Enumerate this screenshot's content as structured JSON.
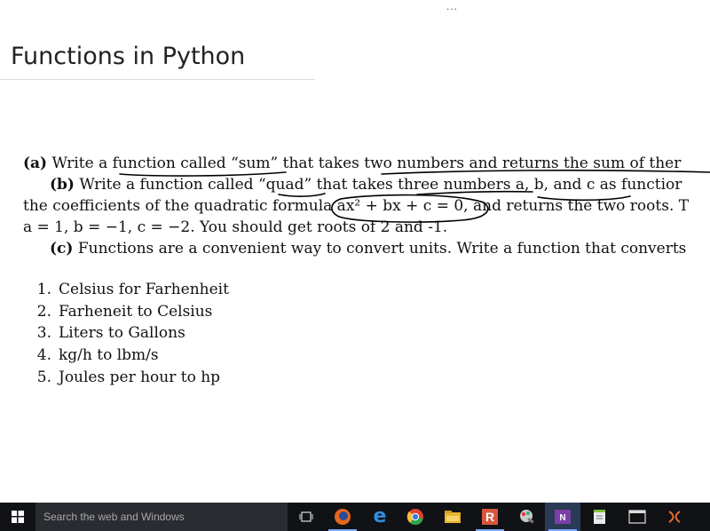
{
  "window": {
    "overflow_dots": "..."
  },
  "slide": {
    "title": "Functions in Python",
    "problem_a": {
      "label": "(a)",
      "text": "Write a function called “sum” that takes two numbers and returns the sum of ther"
    },
    "problem_b": {
      "label": "(b)",
      "line1": "Write a function called “quad” that takes three numbers a, b, and c as functior",
      "line2": "the coefficients of the quadratic formula ax² + bx + c = 0, and returns the two roots.  T",
      "line3": "a = 1, b = −1, c = −2.  You should get roots of 2 and -1."
    },
    "problem_c": {
      "label": "(c)",
      "text": "Functions are a convenient way to convert units.  Write a function that converts"
    },
    "conversions": [
      {
        "num": "1.",
        "text": "Celsius for Farhenheit"
      },
      {
        "num": "2.",
        "text": "Farheneit to Celsius"
      },
      {
        "num": "3.",
        "text": "Liters to Gallons"
      },
      {
        "num": "4.",
        "text": "kg/h to lbm/s"
      },
      {
        "num": "5.",
        "text": "Joules per hour to hp"
      }
    ]
  },
  "taskbar": {
    "search_placeholder": "Search the web and Windows",
    "accent": "#7aa7ff",
    "icons": [
      "windows-start-icon",
      "task-view-icon",
      "firefox-icon",
      "edge-icon",
      "chrome-icon",
      "file-explorer-icon",
      "r-app-icon",
      "paint-icon",
      "onenote-icon",
      "notepad-icon",
      "terminal-icon",
      "snipping-tool-icon"
    ]
  }
}
